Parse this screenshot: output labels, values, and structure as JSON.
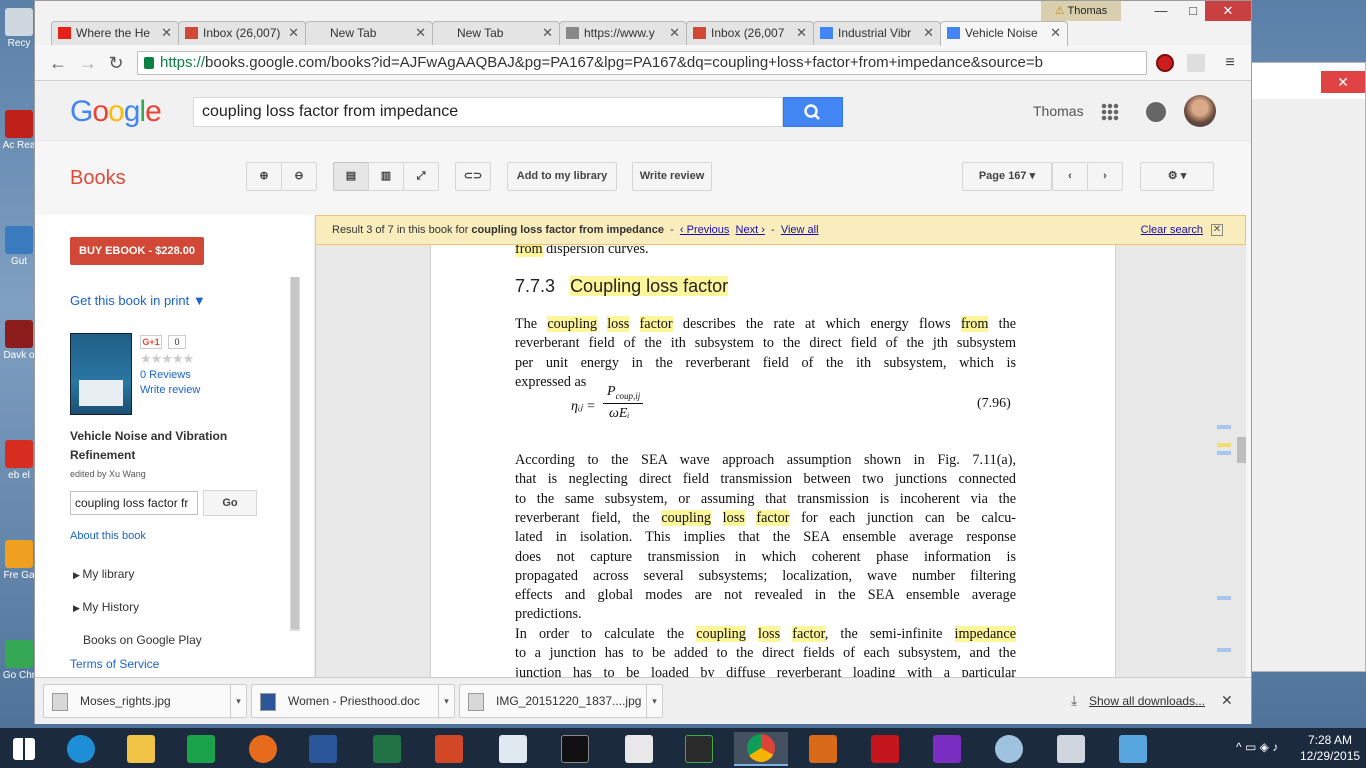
{
  "desktop": {
    "icon_labels": [
      "Recy",
      "Ac Rea",
      "Gut",
      "Davk o",
      "eb el",
      "Fre Ga",
      "Go Chr"
    ]
  },
  "window": {
    "user_chip": "Thomas",
    "minimize": "—",
    "maximize": "□",
    "close": "✕"
  },
  "tabs": [
    {
      "label": "Where the He",
      "icon": "youtube-icon",
      "color": "#e62117"
    },
    {
      "label": "Inbox (26,007)",
      "icon": "gmail-icon",
      "color": "#d14836"
    },
    {
      "label": "New Tab",
      "icon": "",
      "color": ""
    },
    {
      "label": "New Tab",
      "icon": "",
      "color": ""
    },
    {
      "label": "https://www.y",
      "icon": "page-icon",
      "color": "#888888"
    },
    {
      "label": "Inbox (26,007",
      "icon": "gmail-icon",
      "color": "#d14836"
    },
    {
      "label": "Industrial Vibr",
      "icon": "google-icon",
      "color": "#4285f4"
    },
    {
      "label": "Vehicle Noise",
      "icon": "google-icon",
      "color": "#4285f4"
    }
  ],
  "toolbar": {
    "url_scheme": "https://",
    "url_rest": "books.google.com/books?id=AJFwAgAAQBAJ&pg=PA167&lpg=PA167&dq=coupling+loss+factor+from+impedance&source=b"
  },
  "google": {
    "search_value": "coupling loss factor from impedance",
    "user_name": "Thomas"
  },
  "books_bar": {
    "title": "Books",
    "add_library": "Add to my library",
    "write_review": "Write review",
    "page_select": "Page 167"
  },
  "result_bar": {
    "prefix": "Result 3 of 7 in this book for",
    "query": "coupling loss factor from impedance",
    "sep1": "-",
    "previous": "‹ Previous",
    "next": "Next ›",
    "sep2": "-",
    "view_all": "View all",
    "clear": "Clear search"
  },
  "sidebar": {
    "buy": "BUY EBOOK - $228.00",
    "get_print": "Get this book in print ▼",
    "gplus": "G+1",
    "gplus_count": "0",
    "stars": "★★★★★",
    "reviews": "0 Reviews",
    "write_review": "Write review",
    "book_title": "Vehicle Noise and Vibration Refinement",
    "edited_by": "edited by Xu Wang",
    "search_value": "coupling loss factor fr",
    "go": "Go",
    "about": "About this book",
    "my_library": "My library",
    "my_history": "My History",
    "google_play": "Books on Google Play",
    "terms": "Terms of Service"
  },
  "page": {
    "top_line_hl": "from",
    "top_line_rest": " dispersion curves.",
    "section_num": "7.7.3",
    "section_title": "Coupling loss factor",
    "para1": [
      {
        "segs": [
          [
            "The ",
            false
          ],
          [
            "coupling",
            true
          ],
          [
            " ",
            false
          ],
          [
            "loss",
            true
          ],
          [
            " ",
            false
          ],
          [
            "factor",
            true
          ],
          [
            " describes the rate at which energy flows ",
            false
          ],
          [
            "from",
            true
          ],
          [
            " the",
            false
          ]
        ]
      },
      {
        "segs": [
          [
            "reverberant field of the ith subsystem to the direct field of the jth subsystem",
            false
          ]
        ]
      },
      {
        "segs": [
          [
            "per unit energy in the reverberant field of the ith subsystem, which is",
            false
          ]
        ]
      },
      {
        "segs": [
          [
            "expressed as",
            false
          ]
        ],
        "left": true
      }
    ],
    "eq_left": "ηᵢⱼ =",
    "eq_num": "P",
    "eq_num_sub": "coup,ij",
    "eq_den": "ωEᵢ",
    "eq_label": "(7.96)",
    "para2": [
      {
        "segs": [
          [
            "According to the SEA wave approach assumption shown in Fig. 7.11(a),",
            false
          ]
        ]
      },
      {
        "segs": [
          [
            "that is neglecting direct field transmission between two junctions connected",
            false
          ]
        ]
      },
      {
        "segs": [
          [
            "to the same subsystem, or assuming that transmission is incoherent via the",
            false
          ]
        ]
      },
      {
        "segs": [
          [
            "reverberant field, the ",
            false
          ],
          [
            "coupling",
            true
          ],
          [
            " ",
            false
          ],
          [
            "loss",
            true
          ],
          [
            " ",
            false
          ],
          [
            "factor",
            true
          ],
          [
            " for each junction can be calcu-",
            false
          ]
        ]
      },
      {
        "segs": [
          [
            "lated in isolation. This implies that the SEA ensemble average response",
            false
          ]
        ]
      },
      {
        "segs": [
          [
            "does not capture transmission in which coherent phase information is",
            false
          ]
        ]
      },
      {
        "segs": [
          [
            "propagated across several subsystems; localization, wave number filtering",
            false
          ]
        ]
      },
      {
        "segs": [
          [
            "effects and global modes are not revealed in the SEA ensemble average",
            false
          ]
        ]
      },
      {
        "segs": [
          [
            "predictions.",
            false
          ]
        ],
        "left": true
      }
    ],
    "para3": [
      {
        "segs": [
          [
            "    In order to calculate the ",
            false
          ],
          [
            "coupling",
            true
          ],
          [
            " ",
            false
          ],
          [
            "loss",
            true
          ],
          [
            " ",
            false
          ],
          [
            "factor",
            true
          ],
          [
            ", the semi-infinite ",
            false
          ],
          [
            "impedance",
            true
          ]
        ]
      },
      {
        "segs": [
          [
            "to a junction has to be added to the direct fields of each subsystem, and the",
            false
          ]
        ]
      },
      {
        "segs": [
          [
            "junction has to be loaded by diffuse reverberant loading with a particular",
            false
          ]
        ]
      }
    ]
  },
  "downloads": {
    "items": [
      "Moses_rights.jpg",
      "Women - Priesthood.doc",
      "IMG_20151220_1837....jpg"
    ],
    "show_all": "Show all downloads...",
    "close": "✕"
  },
  "taskbar": {
    "time": "7:28 AM",
    "date": "12/29/2015"
  }
}
